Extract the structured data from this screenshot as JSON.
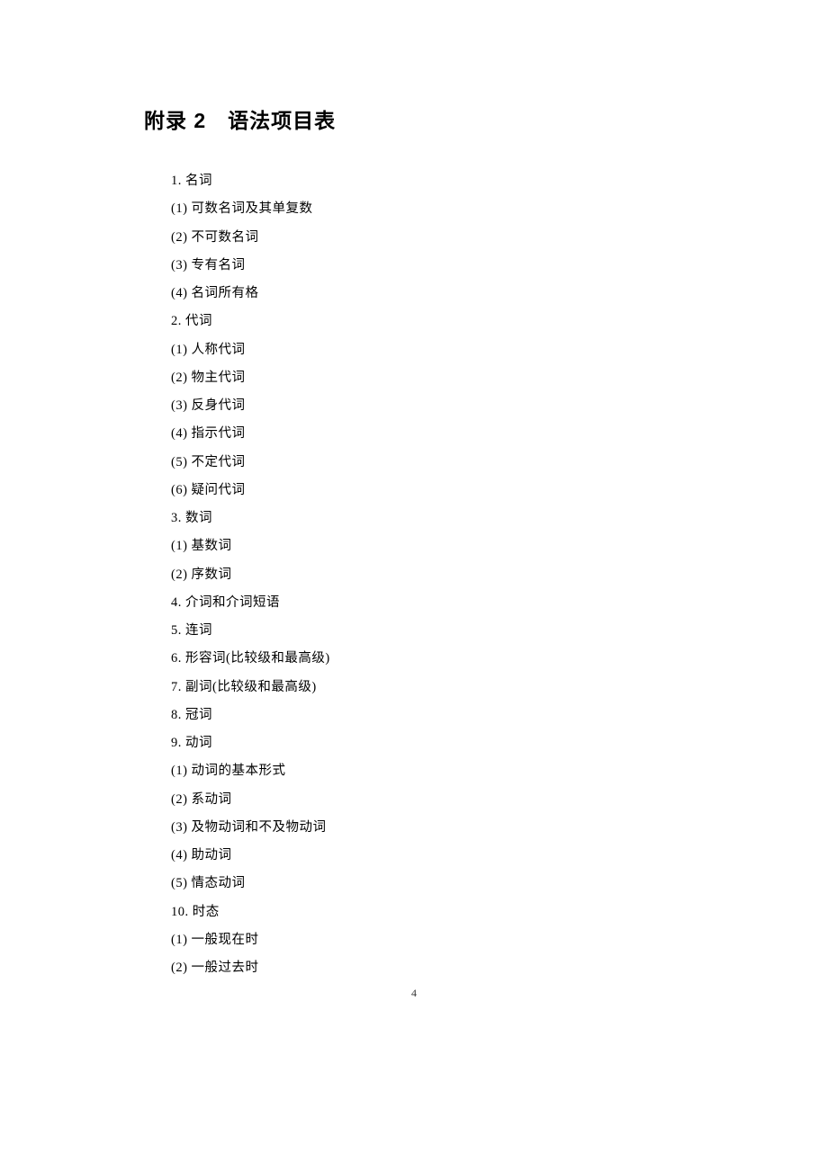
{
  "title": "附录 2　语法项目表",
  "items": [
    "1. 名词",
    "(1) 可数名词及其单复数",
    "(2) 不可数名词",
    "(3) 专有名词",
    "(4) 名词所有格",
    "2. 代词",
    "(1) 人称代词",
    "(2) 物主代词",
    "(3) 反身代词",
    "(4) 指示代词",
    "(5) 不定代词",
    "(6) 疑问代词",
    "3. 数词",
    "(1) 基数词",
    "(2) 序数词",
    "4. 介词和介词短语",
    "5. 连词",
    "6. 形容词(比较级和最高级)",
    "7. 副词(比较级和最高级)",
    "8. 冠词",
    "9. 动词",
    "(1) 动词的基本形式",
    "(2) 系动词",
    "(3) 及物动词和不及物动词",
    "(4) 助动词",
    "(5) 情态动词",
    "10. 时态",
    "(1) 一般现在时",
    "(2) 一般过去时"
  ],
  "page_number": "4"
}
